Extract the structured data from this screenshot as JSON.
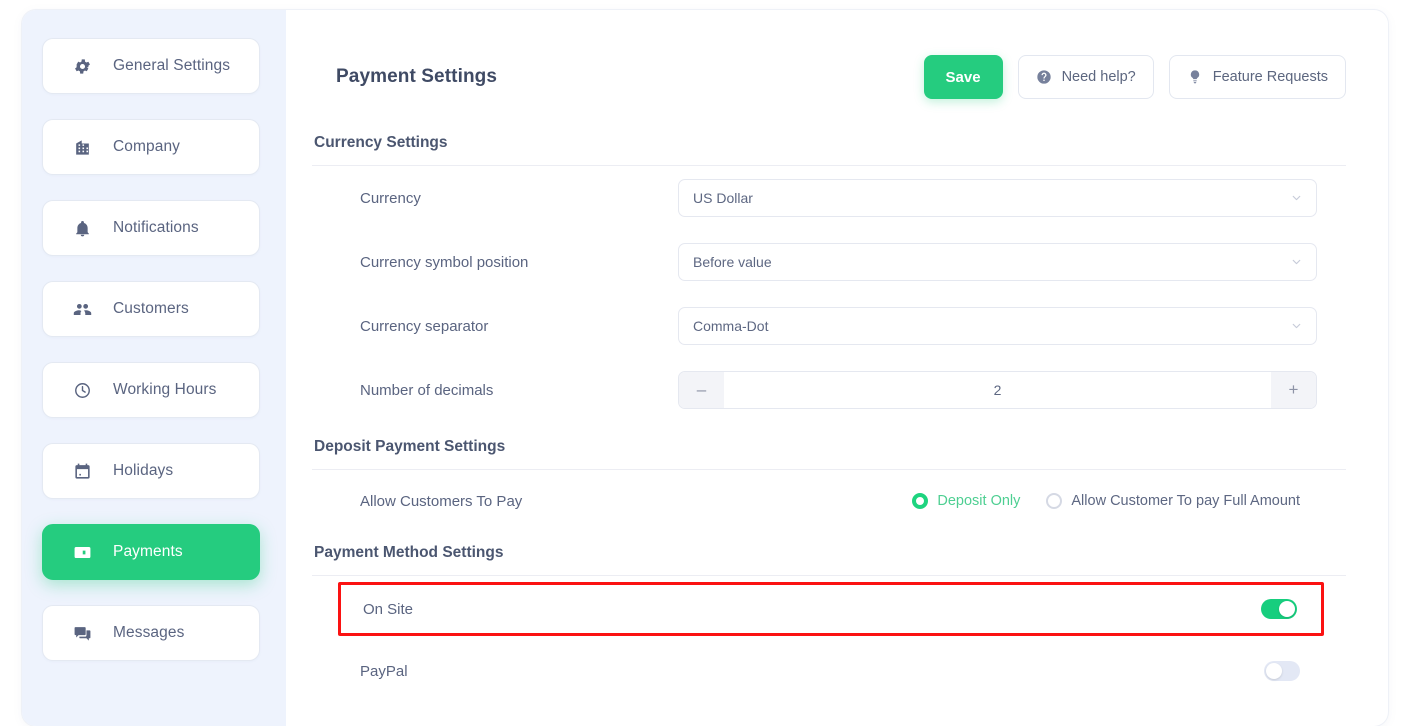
{
  "sidebar": {
    "items": [
      {
        "label": "General Settings",
        "icon": "gear-icon",
        "active": false
      },
      {
        "label": "Company",
        "icon": "building-icon",
        "active": false
      },
      {
        "label": "Notifications",
        "icon": "bell-icon",
        "active": false
      },
      {
        "label": "Customers",
        "icon": "users-icon",
        "active": false
      },
      {
        "label": "Working Hours",
        "icon": "clock-icon",
        "active": false
      },
      {
        "label": "Holidays",
        "icon": "calendar-icon",
        "active": false
      },
      {
        "label": "Payments",
        "icon": "wallet-icon",
        "active": true
      },
      {
        "label": "Messages",
        "icon": "chat-icon",
        "active": false
      }
    ]
  },
  "header": {
    "title": "Payment Settings",
    "save_label": "Save",
    "need_help_label": "Need help?",
    "feature_requests_label": "Feature Requests"
  },
  "currency_section": {
    "title": "Currency Settings",
    "fields": {
      "currency": {
        "label": "Currency",
        "value": "US Dollar"
      },
      "symbol_position": {
        "label": "Currency symbol position",
        "value": "Before value"
      },
      "separator": {
        "label": "Currency separator",
        "value": "Comma-Dot"
      },
      "decimals": {
        "label": "Number of decimals",
        "value": "2",
        "minus": "–",
        "plus": "+"
      }
    }
  },
  "deposit_section": {
    "title": "Deposit Payment Settings",
    "row_label": "Allow Customers To Pay",
    "options": [
      {
        "label": "Deposit Only",
        "selected": true
      },
      {
        "label": "Allow Customer To pay Full Amount",
        "selected": false
      }
    ]
  },
  "payment_method_section": {
    "title": "Payment Method Settings",
    "methods": [
      {
        "label": "On Site",
        "enabled": true,
        "highlighted": true
      },
      {
        "label": "PayPal",
        "enabled": false,
        "highlighted": false
      }
    ]
  },
  "colors": {
    "accent_green": "#25cc7f",
    "toggle_on": "#17ce7e",
    "highlight_red": "#fb1212",
    "sidebar_bg": "#eef3fd",
    "text_muted": "#5a6480"
  }
}
